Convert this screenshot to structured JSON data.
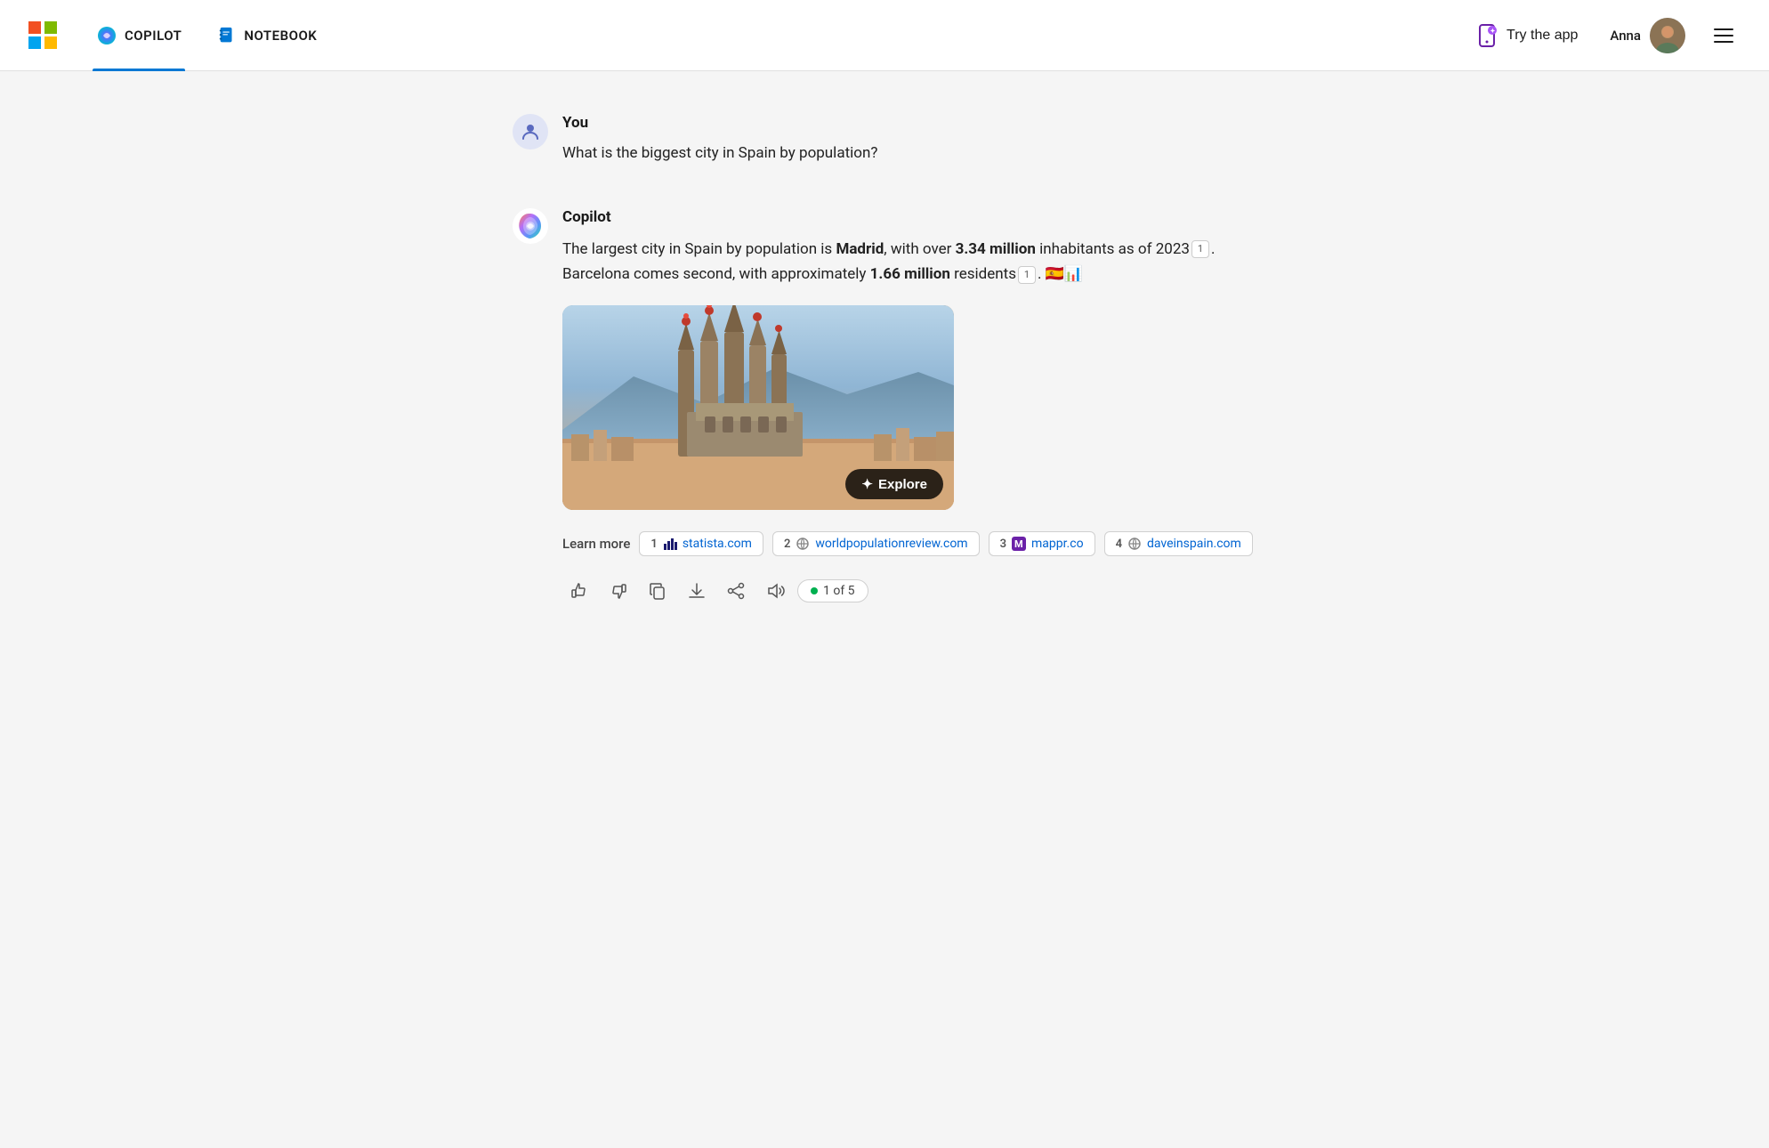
{
  "header": {
    "nav_copilot": "COPILOT",
    "nav_notebook": "NOTEBOOK",
    "try_app_label": "Try the app",
    "user_name": "Anna",
    "hamburger_label": "Menu"
  },
  "user_message": {
    "label": "You",
    "text": "What is the biggest city in Spain by population?"
  },
  "copilot_message": {
    "label": "Copilot",
    "response_p1": "The largest city in Spain by population is ",
    "bold1": "Madrid",
    "response_p2": ", with over ",
    "bold2": "3.34 million",
    "response_p3": " inhabitants as of 2023",
    "response_p4": ". Barcelona comes second, with approximately ",
    "bold3": "1.66 million",
    "response_p5": " residents",
    "response_p6": ".",
    "cite1": "1",
    "cite2": "1",
    "explore_label": "Explore",
    "explore_icon": "✦"
  },
  "learn_more": {
    "label": "Learn more",
    "sources": [
      {
        "num": "1",
        "domain": "statista.com",
        "icon": "chart"
      },
      {
        "num": "2",
        "domain": "worldpopulationreview.com",
        "icon": "globe"
      },
      {
        "num": "3",
        "domain": "mappr.co",
        "icon": "M"
      },
      {
        "num": "4",
        "domain": "daveinspain.com",
        "icon": "globe"
      }
    ]
  },
  "actions": {
    "thumbs_up": "👍",
    "thumbs_down": "👎",
    "copy": "⧉",
    "download": "↓",
    "share": "↗",
    "volume": "🔊",
    "page_indicator": "1 of 5"
  },
  "colors": {
    "accent_blue": "#0078d4",
    "active_underline": "#0064d2"
  }
}
